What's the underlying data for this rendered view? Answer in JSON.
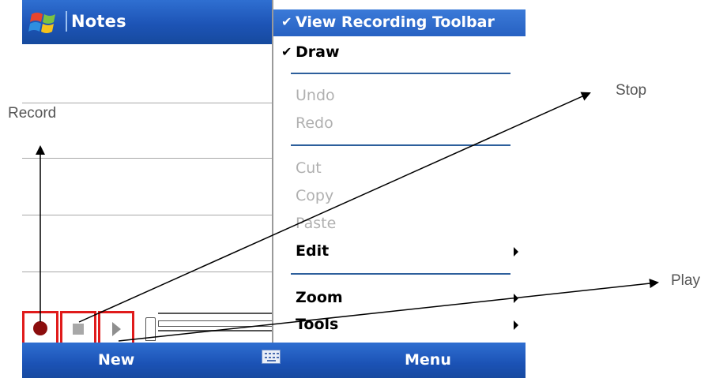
{
  "title_bar": {
    "title": "Notes"
  },
  "menu": {
    "items": [
      {
        "label": "View Recording Toolbar",
        "checked": true,
        "state": "selected"
      },
      {
        "label": "Draw",
        "checked": true,
        "state": "enabled"
      },
      {
        "label": "Undo",
        "state": "disabled"
      },
      {
        "label": "Redo",
        "state": "disabled"
      },
      {
        "label": "Cut",
        "state": "disabled"
      },
      {
        "label": "Copy",
        "state": "disabled"
      },
      {
        "label": "Paste",
        "state": "disabled"
      },
      {
        "label": "Edit",
        "state": "enabled",
        "submenu": true
      },
      {
        "label": "Zoom",
        "state": "enabled",
        "submenu": true
      },
      {
        "label": "Tools",
        "state": "enabled",
        "submenu": true
      }
    ],
    "check_glyph": "✔"
  },
  "recording_toolbar": {
    "buttons": [
      {
        "name": "record",
        "icon": "record-icon"
      },
      {
        "name": "stop",
        "icon": "stop-icon"
      },
      {
        "name": "play",
        "icon": "play-icon"
      }
    ]
  },
  "softkeys": {
    "left": "New",
    "center_icon": "keyboard-icon",
    "right": "Menu"
  },
  "annotations": {
    "record": "Record",
    "stop": "Stop",
    "play": "Play"
  },
  "colors": {
    "titlebar_blue": "#1d54b6",
    "highlight_red": "#e01b1b",
    "record_red": "#8b0d0d",
    "menu_selected": "#2761c2",
    "disabled_text": "#b0b0b0"
  }
}
